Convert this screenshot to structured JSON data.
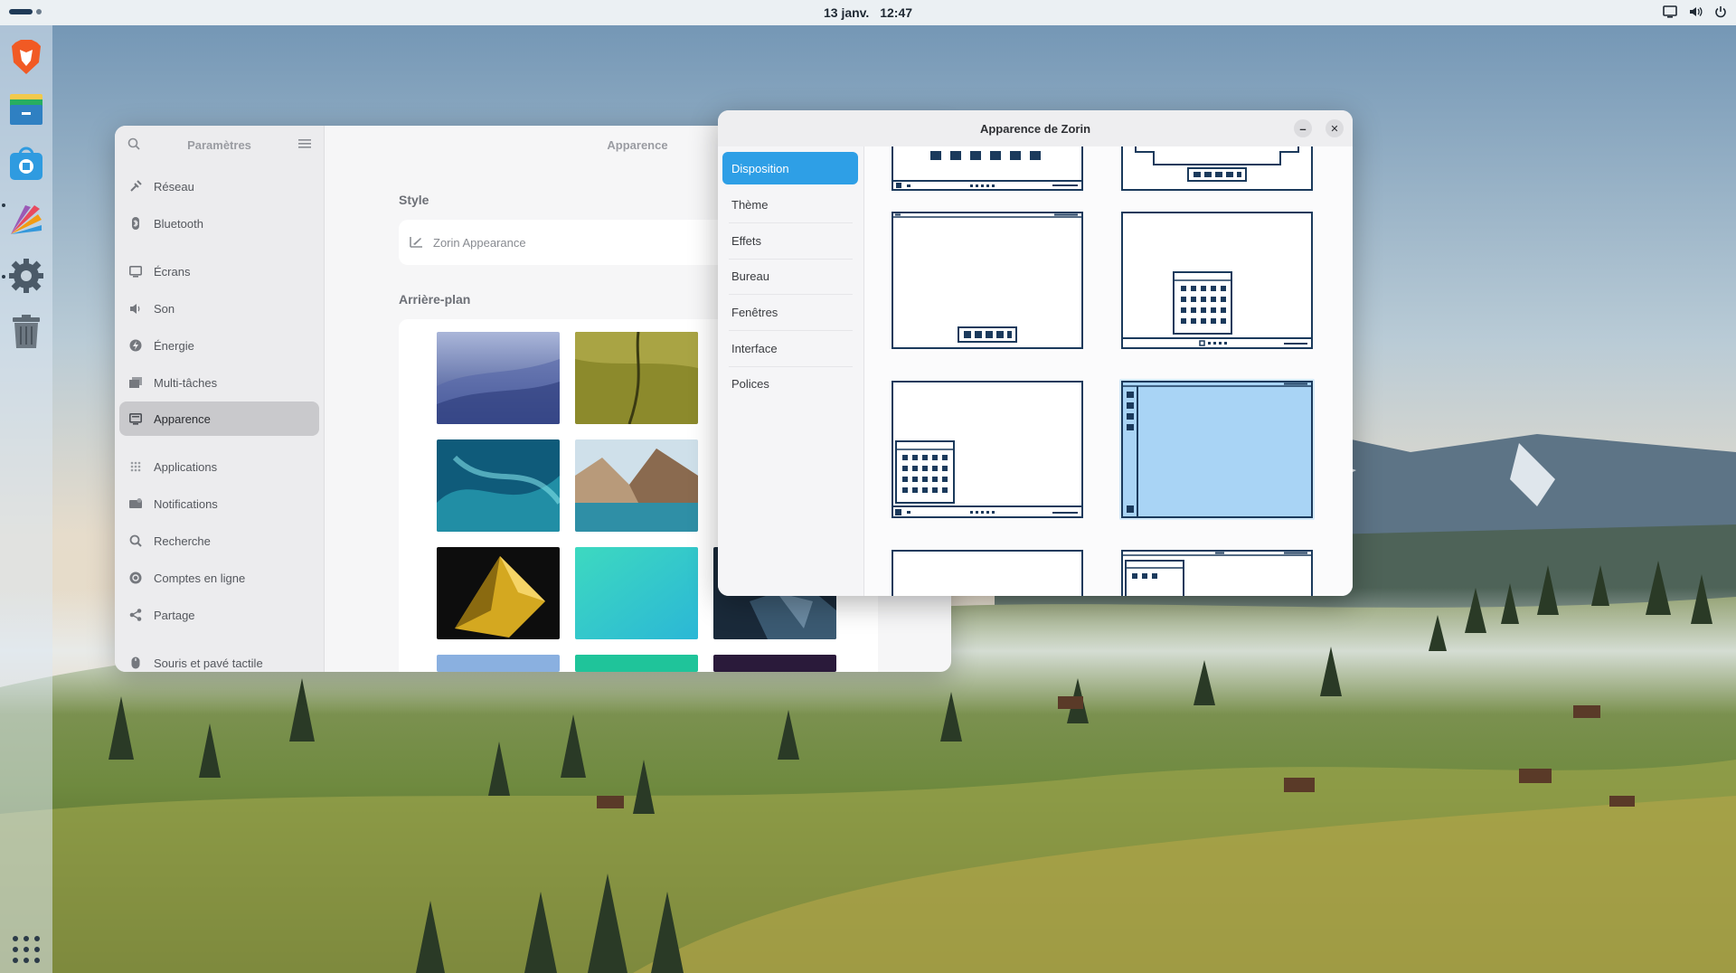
{
  "topbar": {
    "date": "13 janv.",
    "time": "12:47"
  },
  "dock": {
    "items": [
      {
        "name": "brave-browser-icon"
      },
      {
        "name": "files-icon"
      },
      {
        "name": "software-store-icon"
      },
      {
        "name": "paint-app-icon"
      },
      {
        "name": "settings-gear-icon"
      },
      {
        "name": "trash-icon"
      }
    ]
  },
  "settings": {
    "title": "Paramètres",
    "page_title": "Apparence",
    "nav": [
      {
        "label": "Réseau",
        "icon": "network-icon"
      },
      {
        "label": "Bluetooth",
        "icon": "bluetooth-icon"
      },
      {
        "label": "Écrans",
        "icon": "display-icon"
      },
      {
        "label": "Son",
        "icon": "speaker-icon"
      },
      {
        "label": "Énergie",
        "icon": "power-icon"
      },
      {
        "label": "Multi-tâches",
        "icon": "multitask-icon"
      },
      {
        "label": "Apparence",
        "icon": "appearance-icon",
        "active": true
      },
      {
        "label": "Applications",
        "icon": "apps-icon"
      },
      {
        "label": "Notifications",
        "icon": "bell-icon"
      },
      {
        "label": "Recherche",
        "icon": "search-icon"
      },
      {
        "label": "Comptes en ligne",
        "icon": "accounts-icon"
      },
      {
        "label": "Partage",
        "icon": "share-icon"
      },
      {
        "label": "Souris et pavé tactile",
        "icon": "mouse-icon"
      }
    ],
    "style_section": "Style",
    "style_row": "Zorin Appearance",
    "background_section": "Arrière-plan"
  },
  "zorin": {
    "title": "Apparence de Zorin",
    "minimize": "–",
    "close": "✕",
    "tabs": [
      {
        "label": "Disposition",
        "active": true
      },
      {
        "label": "Thème"
      },
      {
        "label": "Effets"
      },
      {
        "label": "Bureau"
      },
      {
        "label": "Fenêtres"
      },
      {
        "label": "Interface"
      },
      {
        "label": "Polices"
      }
    ]
  },
  "colors": {
    "accent": "#2e9fe6",
    "layout_stroke": "#1b3a5c",
    "layout_selected_fill": "#a9d4f5"
  }
}
